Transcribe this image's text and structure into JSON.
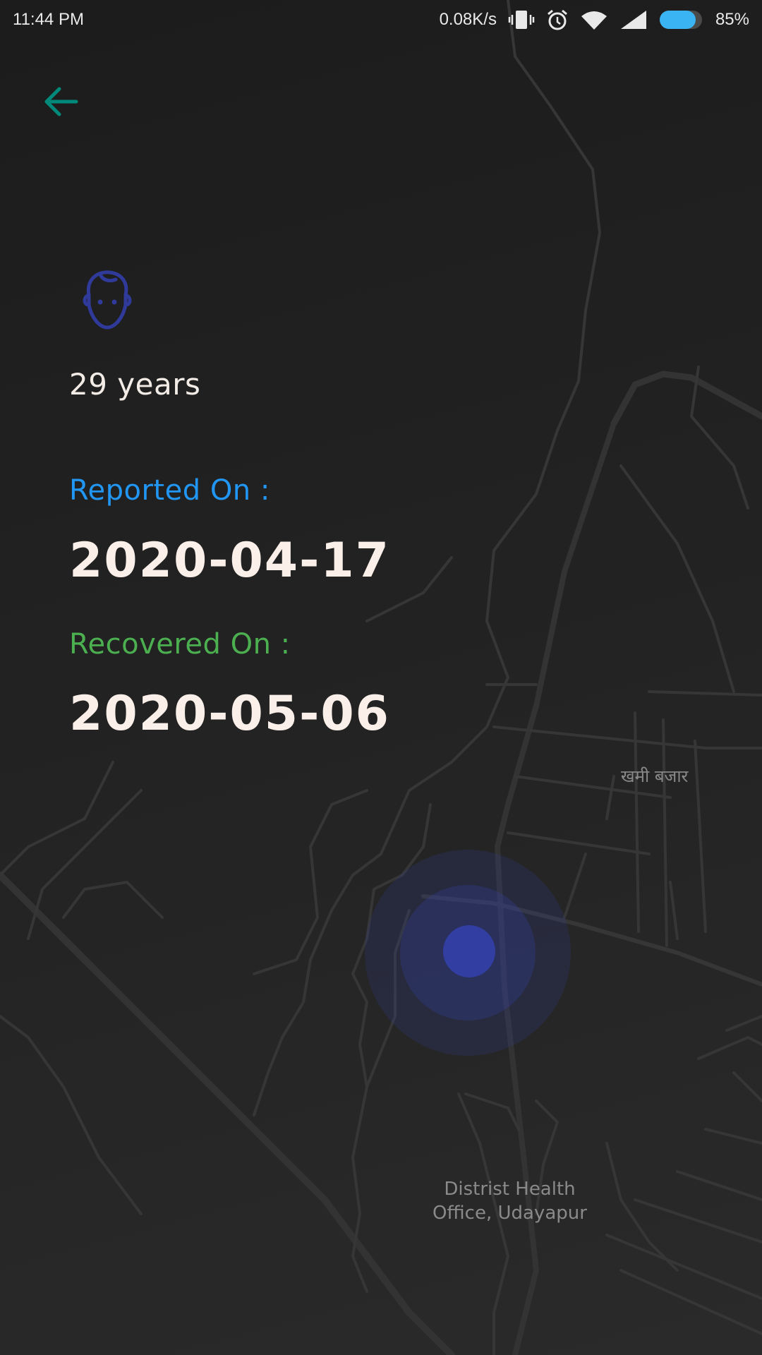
{
  "status_bar": {
    "time": "11:44 PM",
    "network_speed": "0.08K/s",
    "battery_percent": "85%",
    "battery_level": 0.85,
    "icons": [
      "vibrate-icon",
      "alarm-icon",
      "wifi-icon",
      "cell-signal-icon",
      "battery-icon"
    ]
  },
  "toolbar": {
    "back_icon": "arrow-left-icon"
  },
  "patient": {
    "avatar_icon": "male-face-icon",
    "age": "29 years",
    "reported_label": "Reported On :",
    "reported_date": "2020-04-17",
    "recovered_label": "Recovered On :",
    "recovered_date": "2020-05-06"
  },
  "map": {
    "place_label_1": "खमी बजार",
    "place_label_2_line1": "Distrist Health",
    "place_label_2_line2": "Office, Udayapur",
    "marker": "location-pulse-marker"
  },
  "colors": {
    "back_arrow": "#00897b",
    "avatar": "#2f3a9a",
    "reported": "#2196f3",
    "recovered": "#4caf50",
    "marker": "#3340a8",
    "battery": "#3ab4f2"
  }
}
